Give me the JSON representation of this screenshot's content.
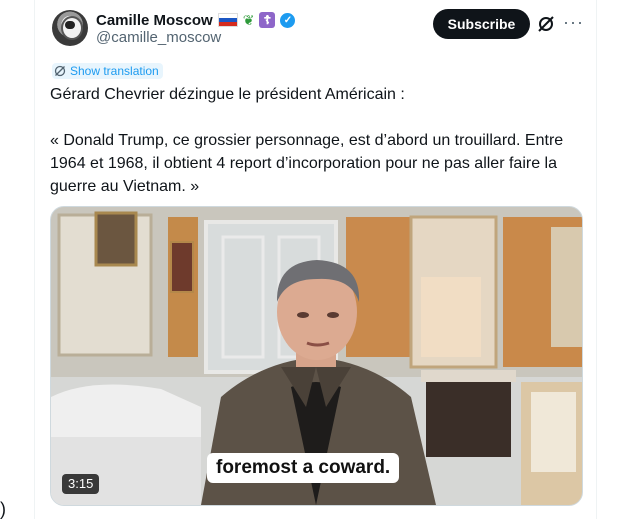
{
  "author": {
    "display_name": "Camille Moscow",
    "handle": "@camille_moscow",
    "badges": [
      "russia-flag",
      "olive-branch",
      "orthodox-cross",
      "verified-badge"
    ]
  },
  "header": {
    "subscribe_label": "Subscribe",
    "more_glyph": "···"
  },
  "translate": {
    "label": "Show translation"
  },
  "tweet": {
    "line1": "Gérard Chevrier dézingue le président Américain :",
    "line2": "« Donald Trump, ce grossier personnage, est d’abord un trouillard. Entre 1964 et 1968, il obtient 4 report d’incorporation pour ne pas aller faire la guerre au Vietnam. »"
  },
  "video": {
    "duration": "3:15",
    "caption": "foremost a coward."
  },
  "colors": {
    "accent": "#1d9bf0",
    "text": "#0f1419",
    "secondary": "#536471",
    "button_bg": "#0f1419"
  }
}
